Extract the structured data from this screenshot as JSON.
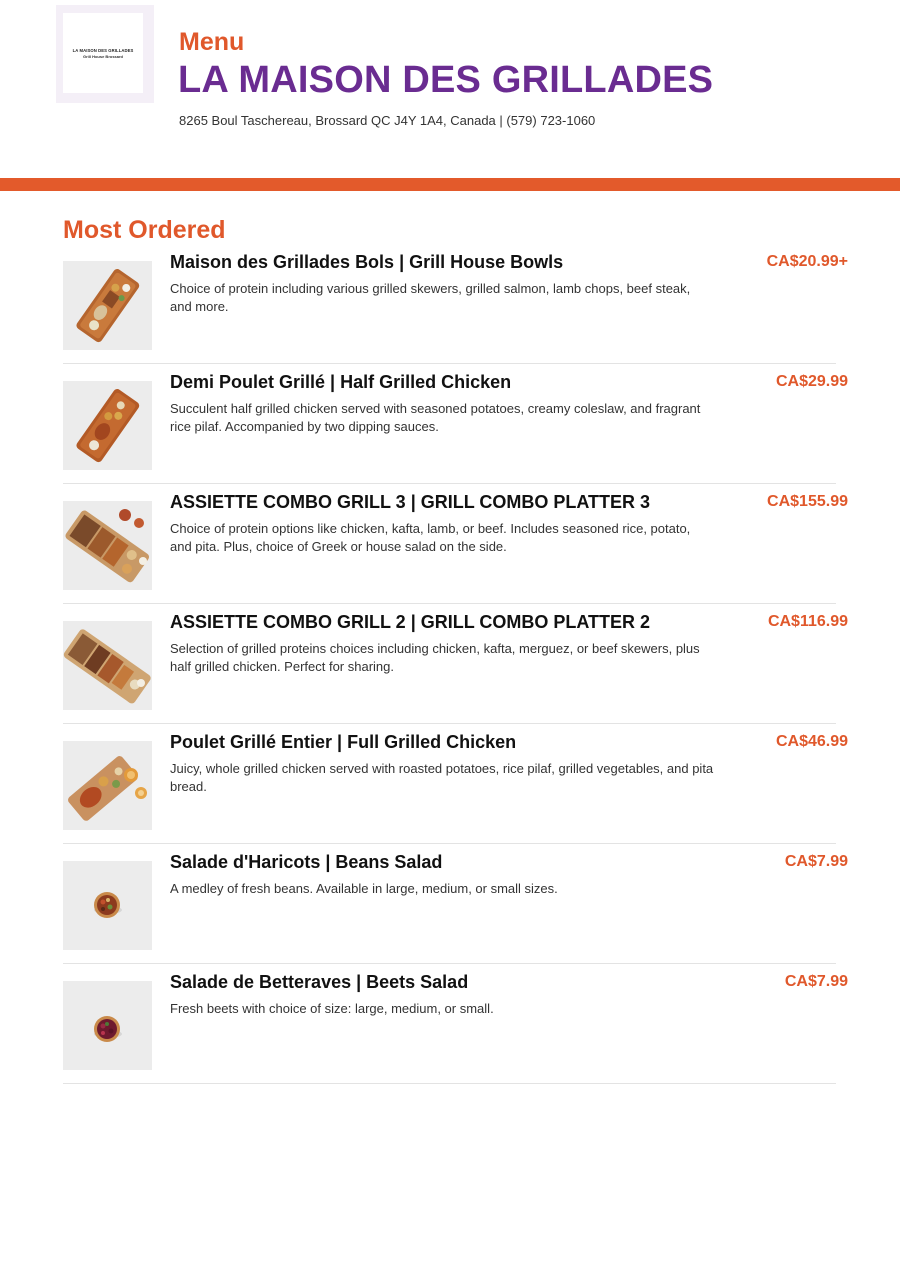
{
  "header": {
    "logo_line1": "LA MAISON DES GRILLADES",
    "logo_line2": "Grill House Brossard",
    "menu_label": "Menu",
    "restaurant_name": "LA MAISON DES GRILLADES",
    "address": "8265 Boul Taschereau, Brossard QC J4Y 1A4, Canada | (579) 723-1060"
  },
  "colors": {
    "accent": "#e35a2b",
    "brand_purple": "#6a2c91"
  },
  "section": {
    "title": "Most Ordered"
  },
  "items": [
    {
      "name": "Maison des Grillades Bols | Grill House Bowls",
      "description": "Choice of protein including various grilled skewers, grilled salmon, lamb chops, beef steak, and more.",
      "price": "CA$20.99+",
      "image_icon": "platter-photo"
    },
    {
      "name": "Demi Poulet Grillé | Half Grilled Chicken",
      "description": "Succulent half grilled chicken served with seasoned potatoes, creamy coleslaw, and fragrant rice pilaf. Accompanied by two dipping sauces.",
      "price": "CA$29.99",
      "image_icon": "platter-photo"
    },
    {
      "name": "ASSIETTE COMBO GRILL 3 | GRILL COMBO PLATTER 3",
      "description": "Choice of protein options like chicken, kafta, lamb, or beef. Includes seasoned rice, potato, and pita. Plus, choice of Greek or house salad on the side.",
      "price": "CA$155.99",
      "image_icon": "platter-photo"
    },
    {
      "name": "ASSIETTE COMBO GRILL 2 | GRILL COMBO PLATTER 2",
      "description": "Selection of grilled proteins choices including chicken, kafta, merguez, or beef skewers, plus half grilled chicken. Perfect for sharing.",
      "price": "CA$116.99",
      "image_icon": "platter-photo"
    },
    {
      "name": "Poulet Grillé Entier | Full Grilled Chicken",
      "description": "Juicy, whole grilled chicken served with roasted potatoes, rice pilaf, grilled vegetables, and pita bread.",
      "price": "CA$46.99",
      "image_icon": "platter-photo"
    },
    {
      "name": "Salade d'Haricots | Beans Salad",
      "description": "A medley of fresh beans. Available in large, medium, or small sizes.",
      "price": "CA$7.99",
      "image_icon": "salad-bowl-photo"
    },
    {
      "name": "Salade de Betteraves | Beets Salad",
      "description": "Fresh beets with choice of size: large, medium, or small.",
      "price": "CA$7.99",
      "image_icon": "salad-bowl-photo"
    }
  ]
}
